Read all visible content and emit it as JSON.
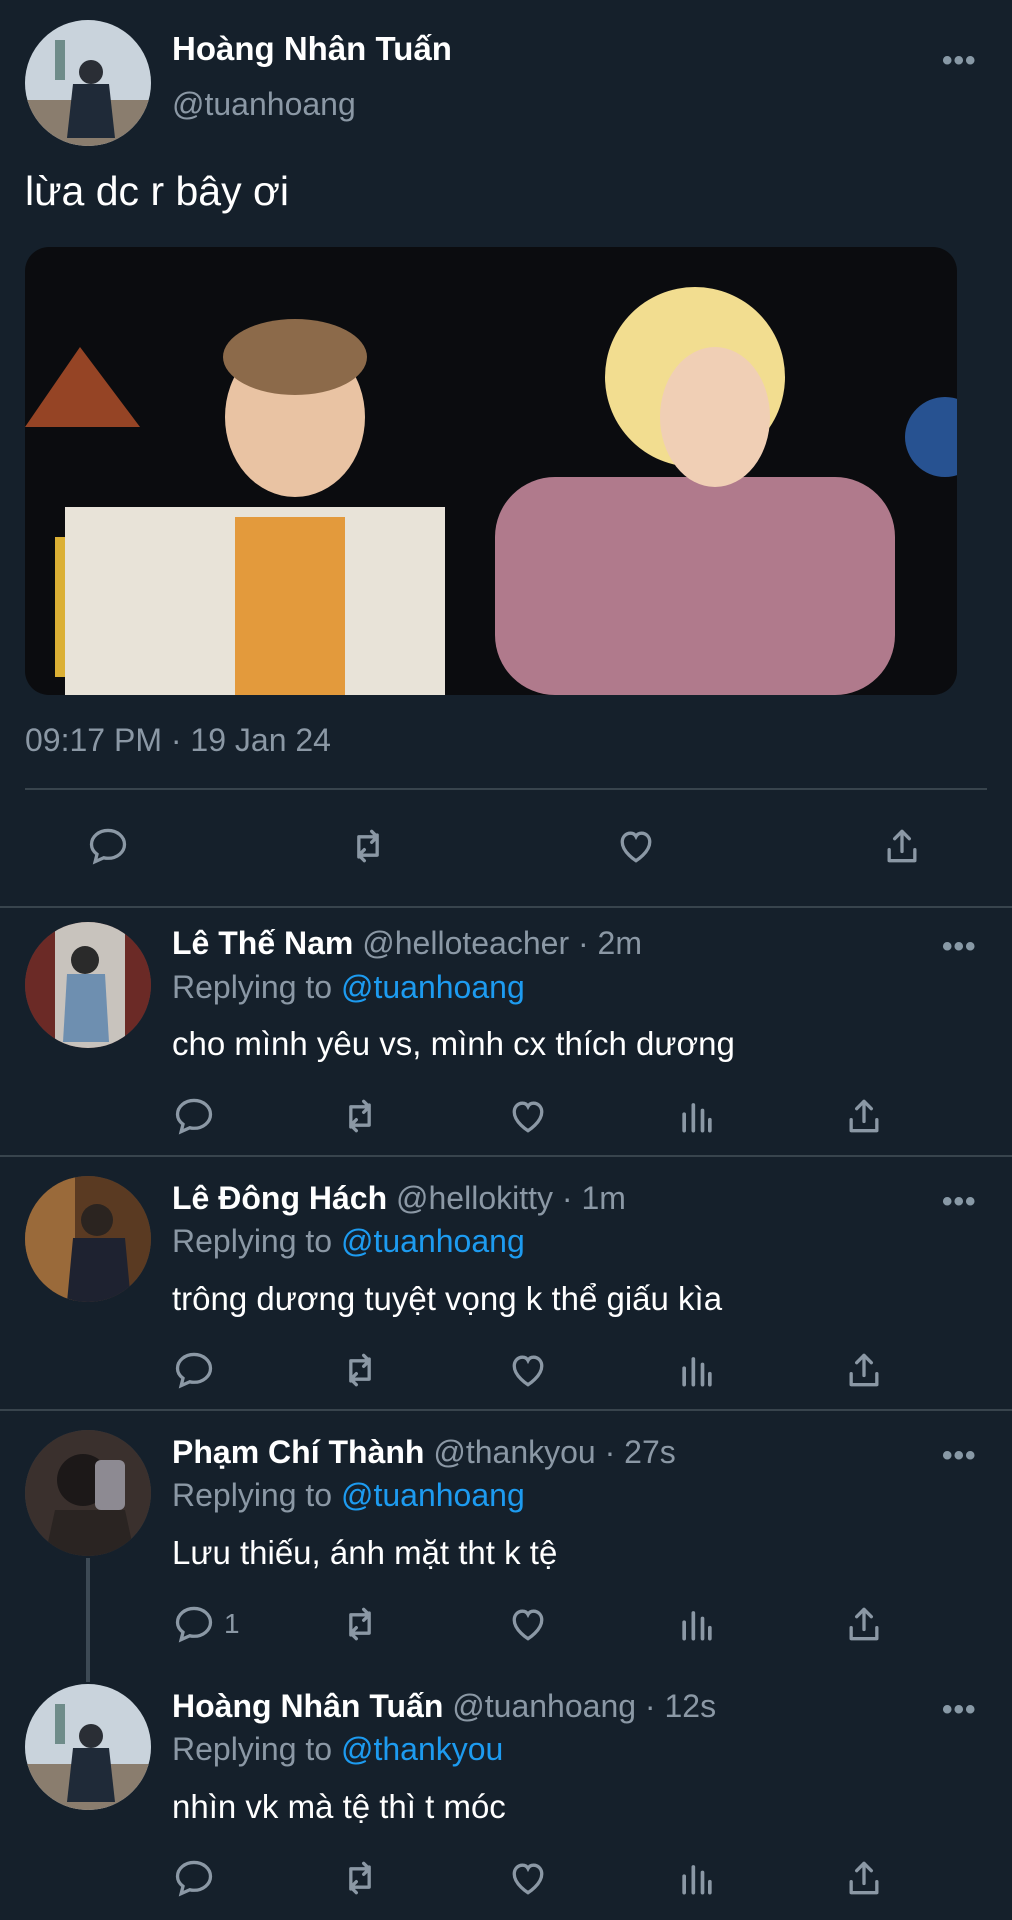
{
  "colors": {
    "background": "#15202b",
    "accent": "#1d9bf0",
    "muted": "#8b98a5",
    "divider": "#38444d"
  },
  "main_tweet": {
    "author_name": "Hoàng Nhân Tuấn",
    "author_handle": "@tuanhoang",
    "text": "lừa dc r bây ơi",
    "timestamp": "09:17 PM · 19 Jan 24",
    "actions": [
      "reply-icon",
      "retweet-icon",
      "like-icon",
      "share-icon"
    ]
  },
  "replies": [
    {
      "name": "Lê Thế Nam",
      "handle_time": "@helloteacher · 2m",
      "replying_label": "Replying to",
      "replying_to": "@tuanhoang",
      "text": "cho mình yêu vs, mình cx thích dương",
      "reply_count": ""
    },
    {
      "name": "Lê Đông Hách",
      "handle_time": "@hellokitty · 1m",
      "replying_label": "Replying to",
      "replying_to": "@tuanhoang",
      "text": "trông dương tuyệt vọng k thể giấu kìa",
      "reply_count": ""
    },
    {
      "name": "Phạm Chí Thành",
      "handle_time": "@thankyou · 27s",
      "replying_label": "Replying to",
      "replying_to": "@tuanhoang",
      "text": "Lưu thiếu, ánh mặt tht k tệ",
      "reply_count": "1"
    },
    {
      "name": "Hoàng Nhân Tuấn",
      "handle_time": "@tuanhoang · 12s",
      "replying_label": "Replying to",
      "replying_to": "@thankyou",
      "text": "nhìn vk mà tệ thì t móc",
      "reply_count": ""
    }
  ]
}
